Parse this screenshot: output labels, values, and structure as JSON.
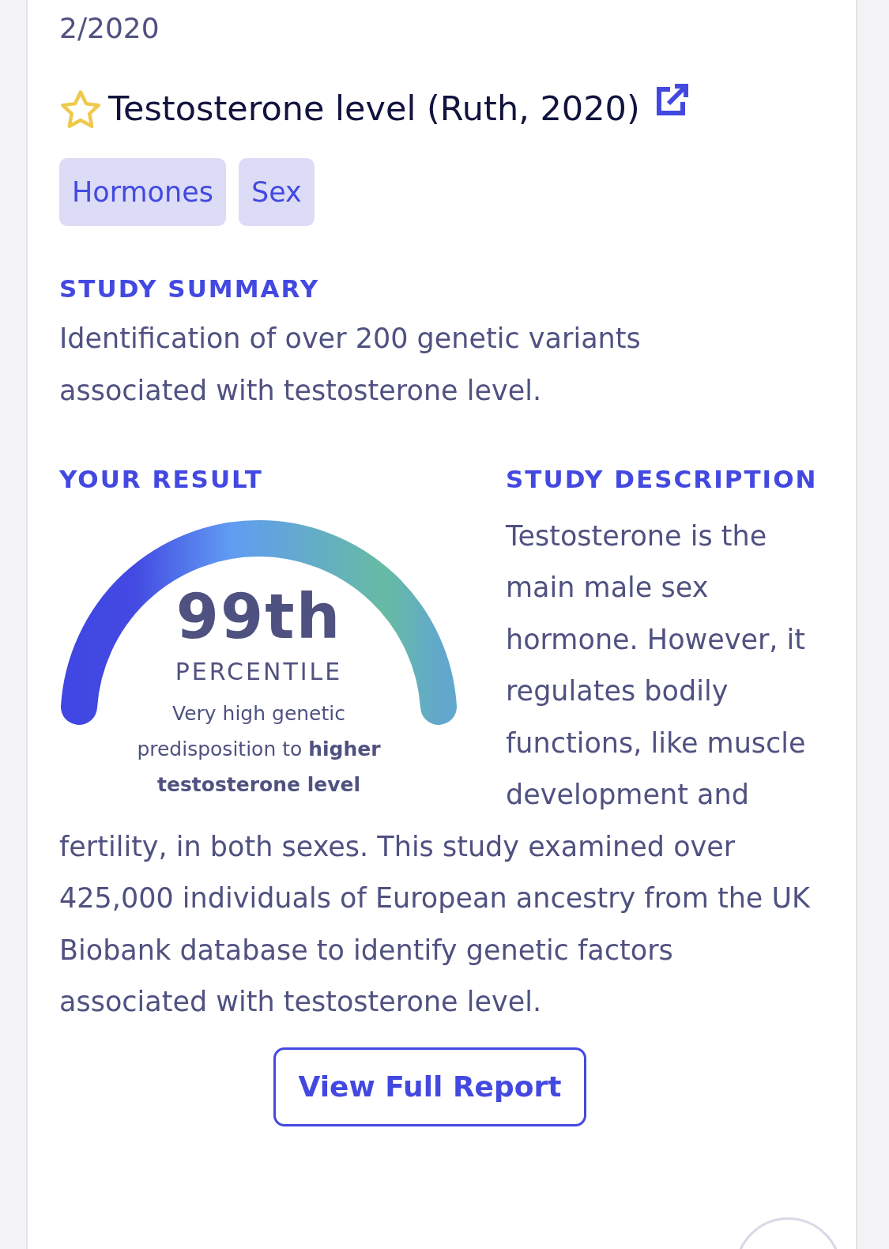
{
  "date": "2/2020",
  "study": {
    "title": "Testosterone level (Ruth, 2020)",
    "favorite": false
  },
  "tags": [
    "Hormones",
    "Sex"
  ],
  "summary": {
    "heading": "STUDY SUMMARY",
    "text": "Identification of over 200 genetic variants associated with testosterone level."
  },
  "result": {
    "heading": "YOUR RESULT",
    "value": "99th",
    "unit": "PERCENTILE",
    "caption": "Very high genetic predisposition to **higher testosterone level**"
  },
  "description": {
    "heading": "STUDY DESCRIPTION",
    "text_beside": "Testosterone is the main male sex hormone. However, it regulates bodily functions, like muscle development and",
    "text_below": "fertility, in both sexes. This study examined over 425,000 individuals of European ancestry from the UK Biobank database to identify genetic factors associated with testosterone level."
  },
  "button": "View Full Report"
}
